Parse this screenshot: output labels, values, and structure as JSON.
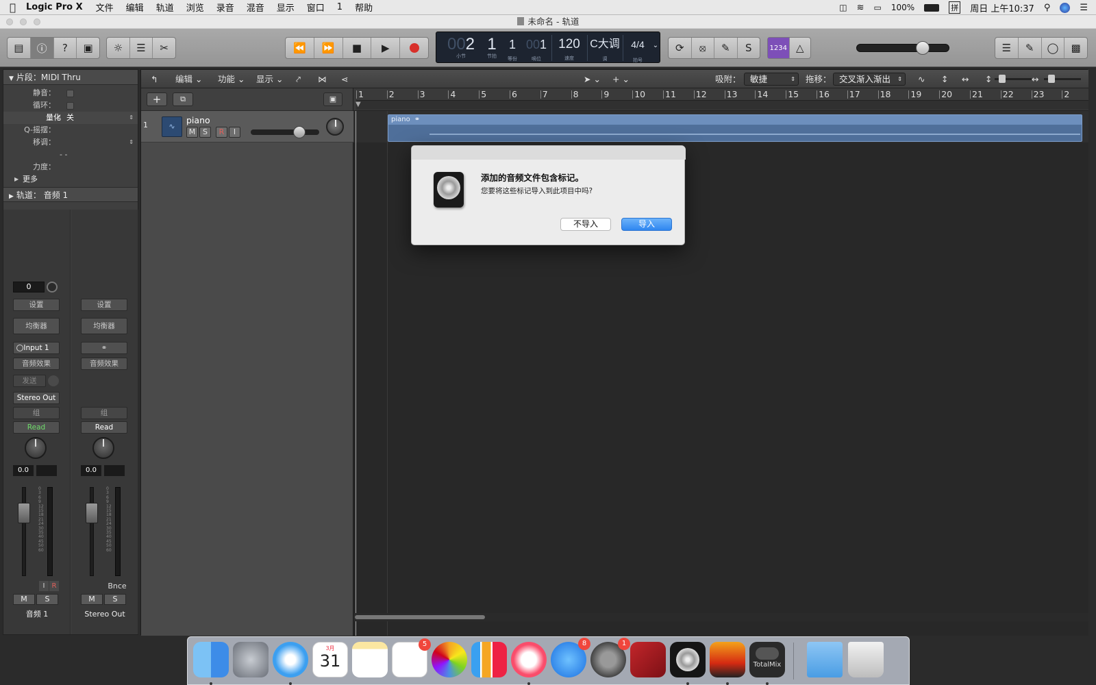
{
  "menubar": {
    "apple": "",
    "app_name": "Logic Pro X",
    "items": [
      "文件",
      "编辑",
      "轨道",
      "浏览",
      "录音",
      "混音",
      "显示",
      "窗口",
      "1",
      "帮助"
    ],
    "battery": "100%",
    "input_method": "拼",
    "clock": "周日 上午10:37"
  },
  "window": {
    "title": "未命名 - 轨道"
  },
  "lcd": {
    "bar_dim": "00",
    "bar": "2",
    "beat": "1",
    "division": "1",
    "tick_dim": "00",
    "tick": "1",
    "tempo": "120",
    "key": "C大调",
    "signature": "4/4",
    "label_bar": "小节",
    "label_beat": "节拍",
    "label_div": "等份",
    "label_tick": "嘀位",
    "label_tempo": "速度",
    "label_key": "调",
    "label_sig": "拍号",
    "counter_mode": "1234"
  },
  "inspector": {
    "region_header": "片段：MIDI Thru",
    "rows": {
      "mute": "静音：",
      "loop": "循环：",
      "quantize": "量化",
      "quantize_value": "关",
      "q_swing": "Q-摇摆：",
      "transpose": "移调：",
      "dash": "- -",
      "velocity": "力度：",
      "more": "更多"
    },
    "track_header": "轨道：  音频 1"
  },
  "strip1": {
    "gain": "0",
    "setting": "设置",
    "eq": "均衡器",
    "input": "Input 1",
    "fx": "音频效果",
    "send": "发送",
    "output": "Stereo Out",
    "group": "组",
    "automation": "Read",
    "pan": "0.0",
    "i": "I",
    "r": "R",
    "m": "M",
    "s": "S",
    "name": "音频 1"
  },
  "strip2": {
    "setting": "设置",
    "eq": "均衡器",
    "fx": "音频效果",
    "group": "组",
    "automation": "Read",
    "pan": "0.0",
    "bnce": "Bnce",
    "m": "M",
    "s": "S",
    "name": "Stereo Out"
  },
  "meter_scale": [
    "0",
    "3",
    "6",
    "9",
    "12",
    "15",
    "18",
    "21",
    "24",
    "30",
    "35",
    "40",
    "45",
    "50",
    "60"
  ],
  "tracks_toolbar": {
    "edit": "编辑",
    "functions": "功能",
    "view": "显示",
    "snap_label": "吸附：",
    "snap_value": "敏捷",
    "drag_label": "拖移：",
    "drag_value": "交叉渐入渐出"
  },
  "track": {
    "number": "1",
    "name": "piano",
    "m": "M",
    "s": "S",
    "r": "R",
    "i": "I",
    "region_name": "piano"
  },
  "ruler": [
    "1",
    "2",
    "3",
    "4",
    "5",
    "6",
    "7",
    "8",
    "9",
    "10",
    "11",
    "12",
    "13",
    "14",
    "15",
    "16",
    "17",
    "18",
    "19",
    "20",
    "21",
    "22",
    "23",
    "2"
  ],
  "dialog": {
    "title": "添加的音频文件包含标记。",
    "message": "您要将这些标记导入到此项目中吗?",
    "cancel": "不导入",
    "confirm": "导入"
  },
  "dock": {
    "calendar_month": "3月",
    "calendar_day": "31",
    "reminders_badge": "5",
    "appstore_badge": "8",
    "prefs_badge": "1",
    "totalmix_label": "TotalMix"
  }
}
